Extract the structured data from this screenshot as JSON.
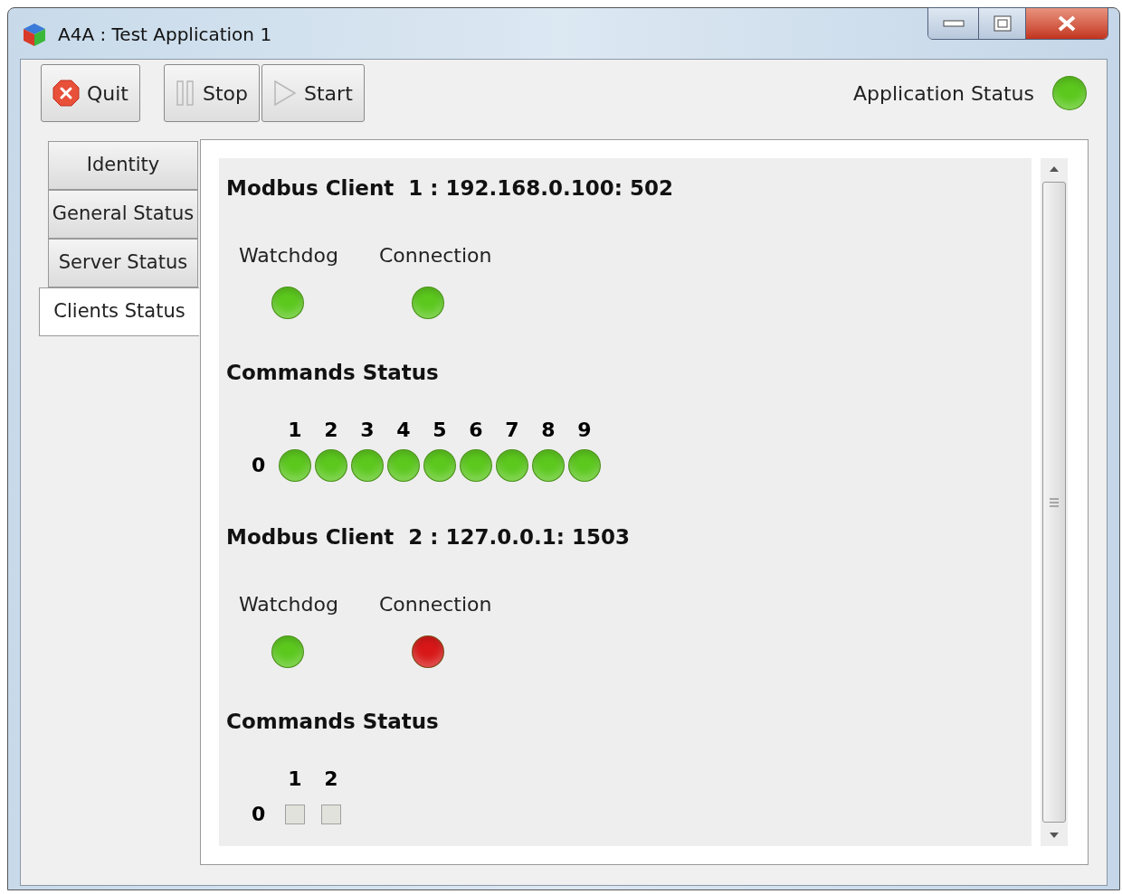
{
  "window": {
    "title": "A4A : Test Application 1"
  },
  "toolbar": {
    "buttons": [
      {
        "label": "Quit",
        "kind": "quit"
      },
      {
        "label": "Stop",
        "kind": "stop"
      },
      {
        "label": "Start",
        "kind": "start"
      }
    ],
    "status": {
      "label": "Application Status",
      "color": "#5cc81e"
    }
  },
  "tabs": [
    {
      "label": "Identity",
      "selected": false
    },
    {
      "label": "General Status",
      "selected": false
    },
    {
      "label": "Server Status",
      "selected": false
    },
    {
      "label": "Clients Status",
      "selected": true
    }
  ],
  "clients": [
    {
      "title": "Modbus Client  1 : 192.168.0.100: 502",
      "indicators": [
        {
          "label": "Watchdog",
          "color": "#5cc81e"
        },
        {
          "label": "Connection",
          "color": "#5cc81e"
        }
      ],
      "commands_title": "Commands Status",
      "row_label": "0",
      "commands": [
        {
          "label": "1",
          "kind": "led",
          "color": "#5cc81e"
        },
        {
          "label": "2",
          "kind": "led",
          "color": "#5cc81e"
        },
        {
          "label": "3",
          "kind": "led",
          "color": "#5cc81e"
        },
        {
          "label": "4",
          "kind": "led",
          "color": "#5cc81e"
        },
        {
          "label": "5",
          "kind": "led",
          "color": "#5cc81e"
        },
        {
          "label": "6",
          "kind": "led",
          "color": "#5cc81e"
        },
        {
          "label": "7",
          "kind": "led",
          "color": "#5cc81e"
        },
        {
          "label": "8",
          "kind": "led",
          "color": "#5cc81e"
        },
        {
          "label": "9",
          "kind": "led",
          "color": "#5cc81e"
        }
      ]
    },
    {
      "title": "Modbus Client  2 : 127.0.0.1: 1503",
      "indicators": [
        {
          "label": "Watchdog",
          "color": "#5cc81e"
        },
        {
          "label": "Connection",
          "color": "#d81818"
        }
      ],
      "commands_title": "Commands Status",
      "row_label": "0",
      "commands": [
        {
          "label": "1",
          "kind": "box"
        },
        {
          "label": "2",
          "kind": "box"
        }
      ]
    }
  ]
}
